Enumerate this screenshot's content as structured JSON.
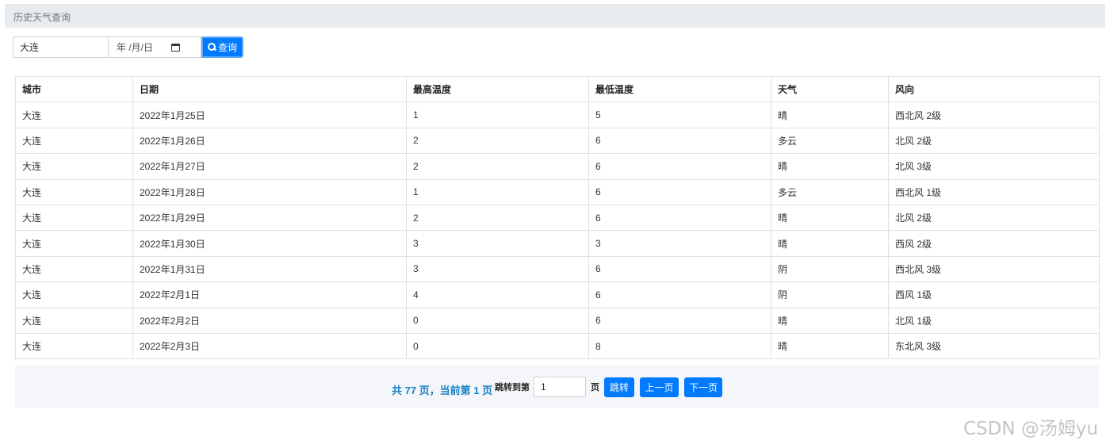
{
  "breadcrumb": {
    "title": "历史天气查询"
  },
  "search": {
    "city_value": "大连",
    "date_placeholder": "年 /月/日",
    "query_label": "查询"
  },
  "table": {
    "headers": [
      "城市",
      "日期",
      "最高温度",
      "最低温度",
      "天气",
      "风向"
    ],
    "rows": [
      [
        "大连",
        "2022年1月25日",
        "1",
        "5",
        "晴",
        "西北风 2级"
      ],
      [
        "大连",
        "2022年1月26日",
        "2",
        "6",
        "多云",
        "北风 2级"
      ],
      [
        "大连",
        "2022年1月27日",
        "2",
        "6",
        "晴",
        "北风 3级"
      ],
      [
        "大连",
        "2022年1月28日",
        "1",
        "6",
        "多云",
        "西北风 1级"
      ],
      [
        "大连",
        "2022年1月29日",
        "2",
        "6",
        "晴",
        "北风 2级"
      ],
      [
        "大连",
        "2022年1月30日",
        "3",
        "3",
        "晴",
        "西风 2级"
      ],
      [
        "大连",
        "2022年1月31日",
        "3",
        "6",
        "阴",
        "西北风 3级"
      ],
      [
        "大连",
        "2022年2月1日",
        "4",
        "6",
        "阴",
        "西风 1级"
      ],
      [
        "大连",
        "2022年2月2日",
        "0",
        "6",
        "晴",
        "北风 1级"
      ],
      [
        "大连",
        "2022年2月3日",
        "0",
        "8",
        "晴",
        "东北风 3级"
      ]
    ]
  },
  "pager": {
    "summary": "共 77 页，当前第 1 页",
    "jump_label": "跳转到第",
    "page_value": "1",
    "page_suffix": "页",
    "jump_button": "跳转",
    "prev_button": "上一页",
    "next_button": "下一页"
  },
  "watermark": "CSDN @汤姆yu",
  "colors": {
    "primary": "#007bff",
    "summary_text": "#1a7fc5",
    "breadcrumb_bg": "#e9ecef"
  }
}
